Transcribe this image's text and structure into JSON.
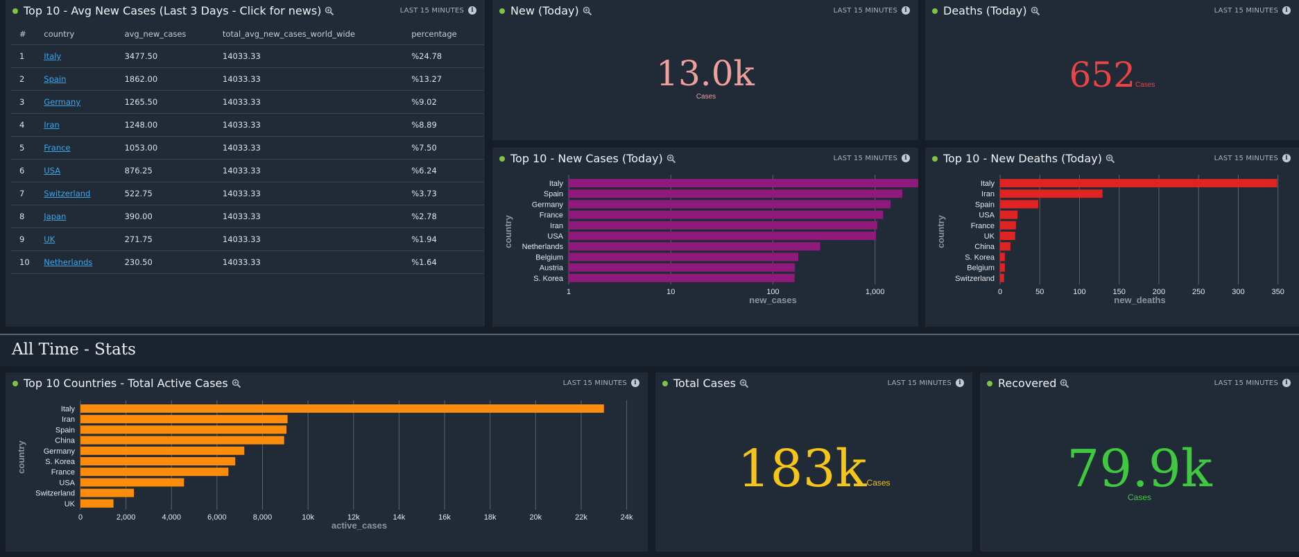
{
  "panels": {
    "avg": {
      "title": "Top 10 - Avg New Cases (Last 3 Days - Click for news)",
      "time_label": "LAST 15 MINUTES",
      "columns": [
        "#",
        "country",
        "avg_new_cases",
        "total_avg_new_cases_world_wide",
        "percentage"
      ],
      "rows": [
        [
          "1",
          "Italy",
          "3477.50",
          "14033.33",
          "%24.78"
        ],
        [
          "2",
          "Spain",
          "1862.00",
          "14033.33",
          "%13.27"
        ],
        [
          "3",
          "Germany",
          "1265.50",
          "14033.33",
          "%9.02"
        ],
        [
          "4",
          "Iran",
          "1248.00",
          "14033.33",
          "%8.89"
        ],
        [
          "5",
          "France",
          "1053.00",
          "14033.33",
          "%7.50"
        ],
        [
          "6",
          "USA",
          "876.25",
          "14033.33",
          "%6.24"
        ],
        [
          "7",
          "Switzerland",
          "522.75",
          "14033.33",
          "%3.73"
        ],
        [
          "8",
          "Japan",
          "390.00",
          "14033.33",
          "%2.78"
        ],
        [
          "9",
          "UK",
          "271.75",
          "14033.33",
          "%1.94"
        ],
        [
          "10",
          "Netherlands",
          "230.50",
          "14033.33",
          "%1.64"
        ]
      ]
    },
    "new_today": {
      "title": "New (Today)",
      "time_label": "LAST 15 MINUTES",
      "value": "13.0k",
      "unit": "Cases",
      "color": "#f0a09a"
    },
    "deaths_today": {
      "title": "Deaths (Today)",
      "time_label": "LAST 15 MINUTES",
      "value": "652",
      "unit": "Cases",
      "color": "#ec4444"
    },
    "top_new_cases": {
      "title": "Top 10 - New Cases (Today)",
      "time_label": "LAST 15 MINUTES"
    },
    "top_new_deaths": {
      "title": "Top 10 - New Deaths (Today)",
      "time_label": "LAST 15 MINUTES"
    },
    "top_active": {
      "title": "Top 10 Countries - Total Active Cases",
      "time_label": "LAST 15 MINUTES"
    },
    "total_cases": {
      "title": "Total Cases",
      "time_label": "LAST 15 MINUTES",
      "value": "183k",
      "unit": "Cases",
      "color": "#f5c518"
    },
    "recovered": {
      "title": "Recovered",
      "time_label": "LAST 15 MINUTES",
      "value": "79.9k",
      "unit": "Cases",
      "color": "#3fc93f"
    }
  },
  "section": {
    "title": "All Time - Stats"
  },
  "chart_data": [
    {
      "id": "new_cases",
      "type": "bar",
      "orientation": "horizontal",
      "color": "#8f1a7c",
      "categories": [
        "Italy",
        "Spain",
        "Germany",
        "France",
        "Iran",
        "USA",
        "Netherlands",
        "Belgium",
        "Austria",
        "S. Korea"
      ],
      "values": [
        3590,
        1850,
        1420,
        1200,
        1050,
        1020,
        290,
        177,
        164,
        163
      ],
      "xscale": "log",
      "xlim": [
        1,
        10000
      ],
      "xticks": [
        1,
        10,
        100,
        1000,
        10000
      ],
      "xtick_labels": [
        "1",
        "10",
        "100",
        "1,000",
        "10k"
      ],
      "xlabel": "new_cases",
      "ylabel": "country",
      "grid": true
    },
    {
      "id": "new_deaths",
      "type": "bar",
      "orientation": "horizontal",
      "color": "#e02424",
      "categories": [
        "Italy",
        "Iran",
        "Spain",
        "USA",
        "France",
        "UK",
        "China",
        "S. Korea",
        "Belgium",
        "Switzerland"
      ],
      "values": [
        349,
        129,
        48,
        22,
        20,
        19,
        13,
        6,
        6,
        5
      ],
      "xscale": "linear",
      "xlim": [
        0,
        352
      ],
      "xticks": [
        0,
        50,
        100,
        150,
        200,
        250,
        300,
        350
      ],
      "xtick_labels": [
        "0",
        "50",
        "100",
        "150",
        "200",
        "250",
        "300",
        "350"
      ],
      "xlabel": "new_deaths",
      "ylabel": "country",
      "grid": true
    },
    {
      "id": "active_cases",
      "type": "bar",
      "orientation": "horizontal",
      "color": "#ff8c0a",
      "categories": [
        "Italy",
        "Iran",
        "Spain",
        "China",
        "Germany",
        "S. Korea",
        "France",
        "USA",
        "Switzerland",
        "UK"
      ],
      "values": [
        23000,
        9100,
        9050,
        8950,
        7200,
        6800,
        6500,
        4550,
        2350,
        1450
      ],
      "xscale": "linear",
      "xlim": [
        0,
        24500
      ],
      "xticks": [
        0,
        2000,
        4000,
        6000,
        8000,
        10000,
        12000,
        14000,
        16000,
        18000,
        20000,
        22000,
        24000
      ],
      "xtick_labels": [
        "0",
        "2,000",
        "4,000",
        "6,000",
        "8,000",
        "10k",
        "12k",
        "14k",
        "16k",
        "18k",
        "20k",
        "22k",
        "24k"
      ],
      "xlabel": "active_cases",
      "ylabel": "country",
      "grid": true
    }
  ]
}
